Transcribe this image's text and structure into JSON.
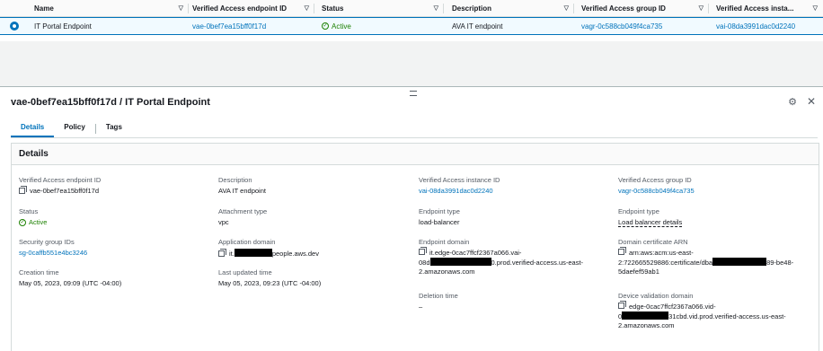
{
  "table": {
    "columns": [
      "Name",
      "Verified Access endpoint ID",
      "Status",
      "Description",
      "Verified Access group ID",
      "Verified Access insta..."
    ],
    "row": {
      "name": "IT Portal Endpoint",
      "endpoint_id": "vae-0bef7ea15bff0f17d",
      "status": "Active",
      "description": "AVA IT endpoint",
      "group_id": "vagr-0c588cb049f4ca735",
      "instance_id": "vai-08da3991dac0d2240"
    }
  },
  "panel": {
    "title": "vae-0bef7ea15bff0f17d / IT Portal Endpoint",
    "tabs": [
      "Details",
      "Policy",
      "Tags"
    ],
    "active_tab": "Details",
    "section_title": "Details",
    "fields": {
      "endpoint_id_label": "Verified Access endpoint ID",
      "endpoint_id_value": "vae-0bef7ea15bff0f17d",
      "description_label": "Description",
      "description_value": "AVA IT endpoint",
      "instance_id_label": "Verified Access instance ID",
      "instance_id_value": "vai-08da3991dac0d2240",
      "group_id_label": "Verified Access group ID",
      "group_id_value": "vagr-0c588cb049f4ca735",
      "status_label": "Status",
      "status_value": "Active",
      "attachment_label": "Attachment type",
      "attachment_value": "vpc",
      "endpoint_type_label": "Endpoint type",
      "endpoint_type_value": "load-balancer",
      "endpoint_type2_label": "Endpoint type",
      "endpoint_type2_value": "Load balancer details",
      "sg_label": "Security group IDs",
      "sg_value": "sg-0caffb551e4bc3246",
      "app_domain_label": "Application domain",
      "app_domain_prefix": "it.",
      "app_domain_suffix": "people.aws.dev",
      "endpoint_domain_label": "Endpoint domain",
      "endpoint_domain_line1": "it.edge-0cac7ffcf2367a066.vai-",
      "endpoint_domain_line2_prefix": "08d",
      "endpoint_domain_line2_suffix": "0.prod.verified-access.us-east-",
      "endpoint_domain_line3": "2.amazonaws.com",
      "cert_label": "Domain certificate ARN",
      "cert_line1": "arn:aws:acm:us-east-",
      "cert_line2_prefix": "2:722665529886:certificate/dba",
      "cert_line2_suffix": "89-be48-",
      "cert_line3": "5daefef59ab1",
      "created_label": "Creation time",
      "created_value": "May 05, 2023, 09:09 (UTC -04:00)",
      "updated_label": "Last updated time",
      "updated_value": "May 05, 2023, 09:23 (UTC -04:00)",
      "deletion_label": "Deletion time",
      "deletion_value": "–",
      "device_label": "Device validation domain",
      "device_line1": "edge-0cac7ffcf2367a066.vid-",
      "device_line2_prefix": "0",
      "device_line2_suffix": "31cbd.vid.prod.verified-access.us-east-",
      "device_line3": "2.amazonaws.com"
    }
  },
  "icons": [
    "sort-icon",
    "radio-selected-icon",
    "check-circle-icon",
    "drag-handle-icon",
    "settings-icon",
    "close-icon",
    "copy-icon"
  ],
  "colors": {
    "link": "#0073bb",
    "success": "#1d8102",
    "selected_row": "#f1faff"
  }
}
